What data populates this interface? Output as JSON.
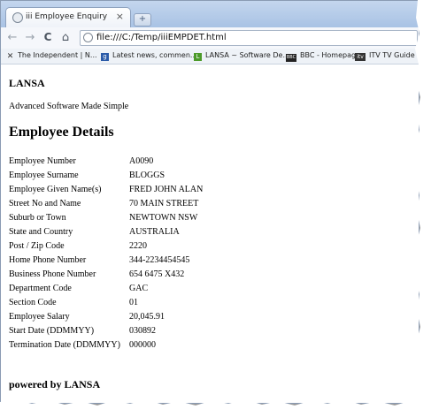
{
  "browser": {
    "tab_title": "iii Employee Enquiry",
    "tab_close": "×",
    "new_tab": "+",
    "address": "file:///C:/Temp/iiiEMPDET.html",
    "nav": {
      "back": "←",
      "forward": "→",
      "reload": "C",
      "home": "⌂"
    }
  },
  "bookmarks": [
    {
      "label": "The Independent | N...",
      "icon": "independent-logo-icon",
      "icon_text": "",
      "color": "#3b3b3b"
    },
    {
      "label": "Latest news, commen...",
      "icon": "guardian-logo-icon",
      "icon_text": "g",
      "color": "#2a5aa8"
    },
    {
      "label": "LANSA ~ Software De...",
      "icon": "lansa-logo-icon",
      "icon_text": "L",
      "color": "#4c9a2a"
    },
    {
      "label": "BBC - Homepage",
      "icon": "bbc-logo-icon",
      "icon_text": "BBC",
      "color": "#222222"
    },
    {
      "label": "ITV TV Guide",
      "icon": "itv-logo-icon",
      "icon_text": "itv",
      "color": "#333333"
    }
  ],
  "page": {
    "brand": "LANSA",
    "tagline": "Advanced Software Made Simple",
    "heading": "Employee Details",
    "footer": "powered by LANSA",
    "fields": [
      {
        "label": "Employee Number",
        "value": "A0090"
      },
      {
        "label": "Employee Surname",
        "value": "BLOGGS"
      },
      {
        "label": "Employee Given Name(s)",
        "value": "FRED JOHN ALAN"
      },
      {
        "label": "Street No and Name",
        "value": "70 MAIN STREET"
      },
      {
        "label": "Suburb or Town",
        "value": "NEWTOWN NSW"
      },
      {
        "label": "State and Country",
        "value": "AUSTRALIA"
      },
      {
        "label": "Post / Zip Code",
        "value": "2220"
      },
      {
        "label": "Home Phone Number",
        "value": "344-2234454545"
      },
      {
        "label": "Business Phone Number",
        "value": "654 6475 X432"
      },
      {
        "label": "Department Code",
        "value": "GAC"
      },
      {
        "label": "Section Code",
        "value": "01"
      },
      {
        "label": "Employee Salary",
        "value": "20,045.91"
      },
      {
        "label": "Start Date (DDMMYY)",
        "value": "030892"
      },
      {
        "label": "Termination Date (DDMMYY)",
        "value": "000000"
      }
    ]
  }
}
